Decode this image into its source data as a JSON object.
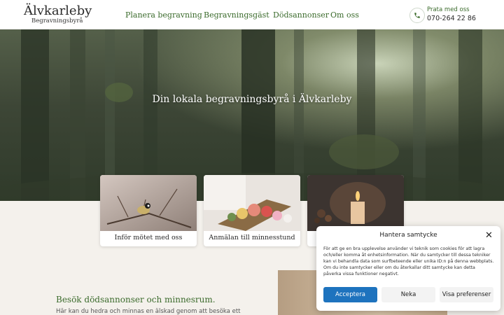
{
  "header": {
    "logo_name": "Älvkarleby",
    "logo_sub": "Begravningsbyrå",
    "nav": [
      "Planera begravning",
      "Begravningsgäst",
      "Dödsannonser",
      "Om oss"
    ],
    "contact_label": "Prata med oss",
    "contact_phone": "070-264 22 86"
  },
  "hero": {
    "title": "Din lokala begravningsbyrå i Älvkarleby"
  },
  "cards": [
    {
      "label": "Inför mötet med oss",
      "icon": "bird-photo"
    },
    {
      "label": "Anmälan till minnesstund",
      "icon": "flowers-photo"
    },
    {
      "label": "",
      "icon": "candle-photo"
    }
  ],
  "section": {
    "title": "Besök dödsannonser och minnesrum.",
    "text": "Här kan du hedra och minnas en älskad genom att besöka ett"
  },
  "consent": {
    "title": "Hantera samtycke",
    "body": "För att ge en bra upplevelse använder vi teknik som cookies för att lagra och/eller komma åt enhetsinformation. När du samtycker till dessa tekniker kan vi behandla data som surfbeteende eller unika ID:n på denna webbplats. Om du inte samtycker eller om du återkallar ditt samtycke kan detta påverka vissa funktioner negativt.",
    "accept": "Acceptera",
    "deny": "Neka",
    "preferences": "Visa preferenser"
  },
  "colors": {
    "accent_green": "#3b6b2c",
    "accept_blue": "#1e73be",
    "page_bg": "#f4f1ec"
  }
}
